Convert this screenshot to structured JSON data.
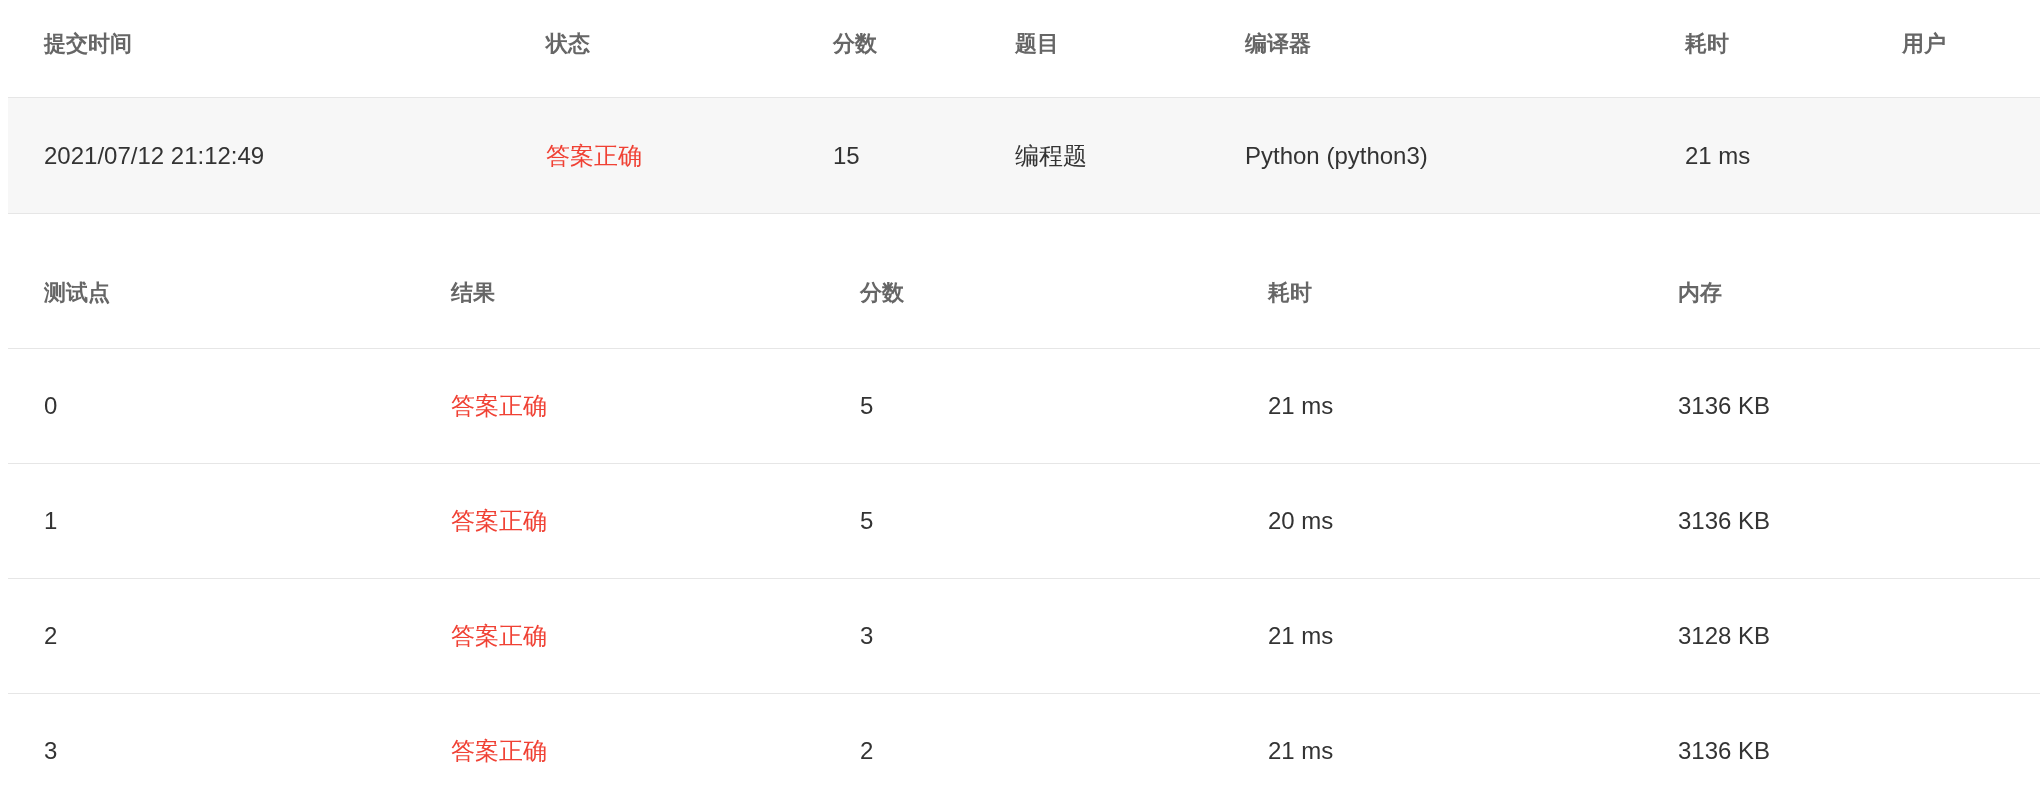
{
  "submission": {
    "columns": [
      "提交时间",
      "状态",
      "分数",
      "题目",
      "编译器",
      "耗时",
      "用户"
    ],
    "row": {
      "time": "2021/07/12 21:12:49",
      "status": "答案正确",
      "score": "15",
      "problem": "编程题",
      "compiler": "Python (python3)",
      "elapsed": "21 ms"
    }
  },
  "test_points": {
    "columns": [
      "测试点",
      "结果",
      "分数",
      "耗时",
      "内存"
    ],
    "rows": [
      {
        "case": "0",
        "result": "答案正确",
        "score": "5",
        "elapsed": "21 ms",
        "memory": "3136 KB"
      },
      {
        "case": "1",
        "result": "答案正确",
        "score": "5",
        "elapsed": "20 ms",
        "memory": "3136 KB"
      },
      {
        "case": "2",
        "result": "答案正确",
        "score": "3",
        "elapsed": "21 ms",
        "memory": "3128 KB"
      },
      {
        "case": "3",
        "result": "答案正确",
        "score": "2",
        "elapsed": "21 ms",
        "memory": "3136 KB"
      }
    ]
  }
}
